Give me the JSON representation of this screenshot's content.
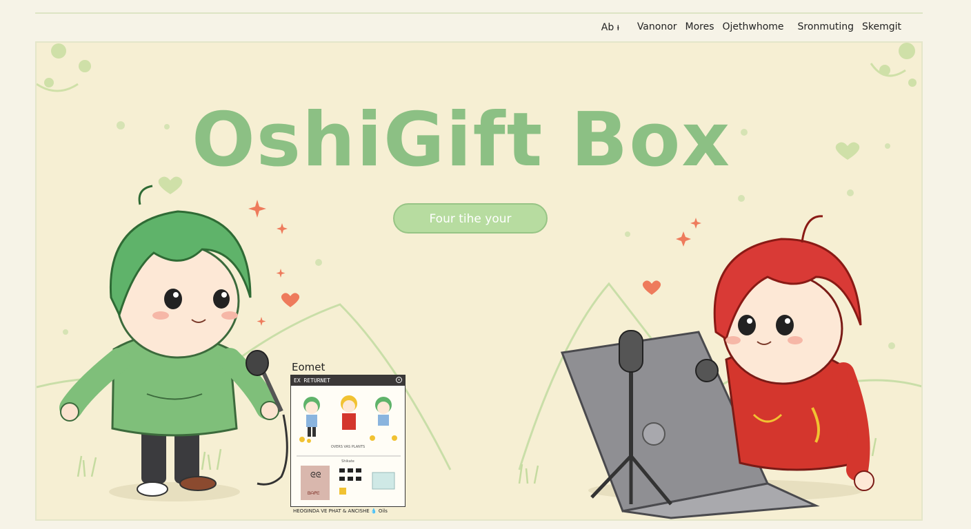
{
  "nav": {
    "items": [
      "Ab ᵼ",
      "Vanonor",
      "Mores",
      "Ojethwhome",
      "Sronmuting",
      "Skemgit"
    ]
  },
  "hero": {
    "title": "OshiGift Box",
    "cta_label": "Four tihe your"
  },
  "card": {
    "heading": "Eomet",
    "window_title": "EX RETURNET",
    "caption": "OVERS VAS PLANTS",
    "section": "Shikate",
    "tile_text": "ᘓᘓ",
    "tile_sub": "ᗷᗩᑭᗴ",
    "footer": "HEOGINDA VE PHAT & ANCISHE   💧 Oils"
  },
  "colors": {
    "title_green": "#8cc084",
    "cta_green": "#b7dca0",
    "hero_bg": "#f6efd3",
    "page_bg": "#f6f3e7",
    "hoodie_green": "#7fbf7a",
    "hair_green": "#5fb36a",
    "hair_red": "#d93a36",
    "hoodie_red": "#d4362d",
    "laptop_gray": "#8f8f93"
  }
}
